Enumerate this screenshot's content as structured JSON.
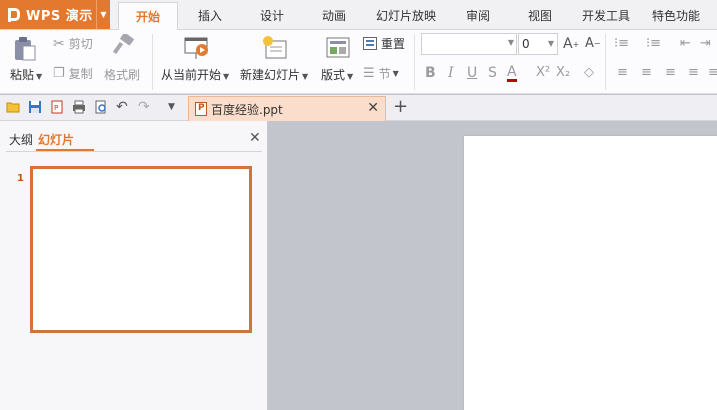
{
  "app": {
    "name": "WPS 演示"
  },
  "menu_tabs": [
    "开始",
    "插入",
    "设计",
    "动画",
    "幻灯片放映",
    "审阅",
    "视图",
    "开发工具",
    "特色功能"
  ],
  "ribbon": {
    "paste": "粘贴",
    "cut": "剪切",
    "copy": "复制",
    "format_painter": "格式刷",
    "from_current": "从当前开始",
    "new_slide": "新建幻灯片",
    "layout": "版式",
    "reset": "重置",
    "section": "节",
    "font_size": "0"
  },
  "document": {
    "tab_title": "百度经验.ppt"
  },
  "panel": {
    "tab_outline": "大纲",
    "tab_slides": "幻灯片",
    "slide_number": "1"
  },
  "colors": {
    "accent": "#e3792f",
    "canvas": "#c3c5cc"
  }
}
